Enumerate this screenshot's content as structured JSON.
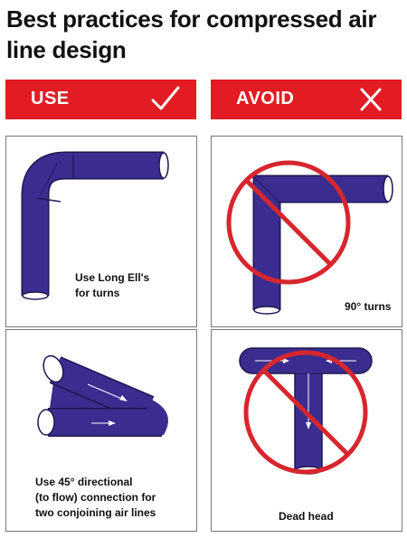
{
  "title": "Best practices for compressed air line design",
  "columns": {
    "use": {
      "label": "USE",
      "mark_icon": "checkmark-icon"
    },
    "avoid": {
      "label": "AVOID",
      "mark_icon": "x-mark-icon"
    }
  },
  "colors": {
    "banner_red": "#e31b23",
    "pipe_blue": "#3a2d8f",
    "prohibition_red": "#d7262e"
  },
  "panels": [
    {
      "caption_lines": [
        "Use Long Ell's",
        "for turns"
      ]
    },
    {
      "caption_lines": [
        "90° turns"
      ]
    },
    {
      "caption_lines": [
        "Use 45° directional",
        "(to flow) connection for",
        "two conjoining air lines"
      ]
    },
    {
      "caption_lines": [
        "Dead head"
      ]
    }
  ]
}
